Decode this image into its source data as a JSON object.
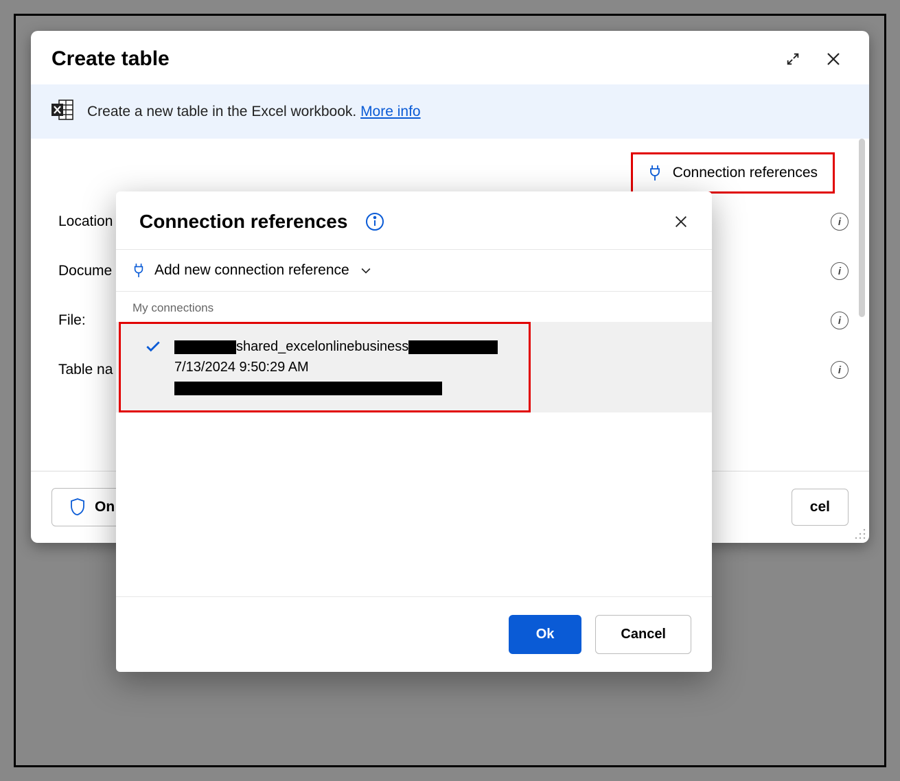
{
  "dialog": {
    "title": "Create table",
    "info_text": "Create a new table in the Excel workbook.",
    "more_link": "More info",
    "conn_ref_button": "Connection references",
    "fields": {
      "location": "Location",
      "document": "Docume",
      "file": "File:",
      "table_name": "Table na"
    },
    "only_button": "On",
    "cancel_button_trunc": "cel"
  },
  "popover": {
    "title": "Connection references",
    "add_new": "Add new connection reference",
    "my_connections": "My connections",
    "connection": {
      "name_middle": "shared_excelonlinebusiness",
      "timestamp": "7/13/2024 9:50:29 AM"
    },
    "ok": "Ok",
    "cancel": "Cancel"
  }
}
